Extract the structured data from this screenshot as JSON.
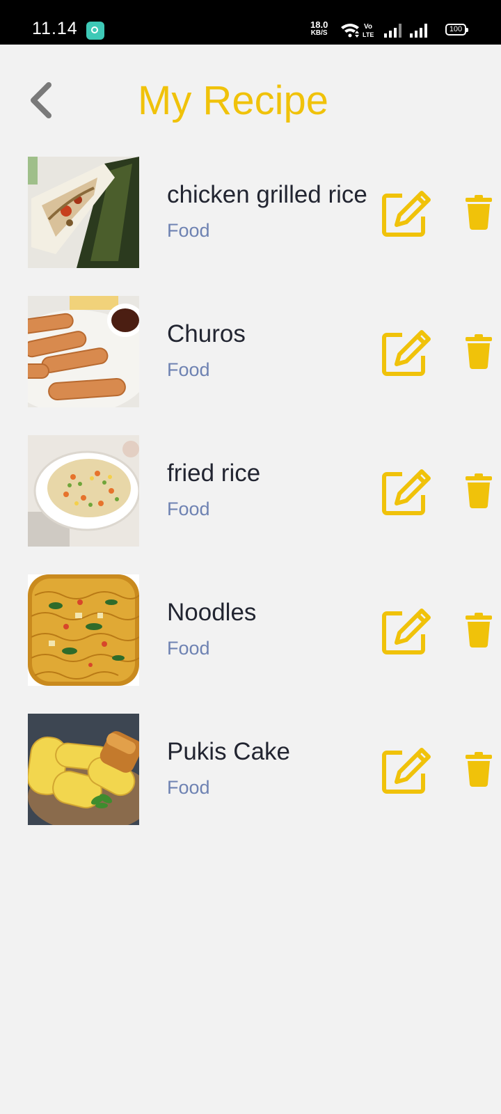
{
  "status_bar": {
    "time": "11.14",
    "net_speed": "18.0",
    "net_speed_unit": "KB/S",
    "volte": "Vo",
    "volte_sub": "LTE",
    "battery": "100"
  },
  "header": {
    "back_icon": "chevron-left-icon",
    "title": "My Recipe"
  },
  "colors": {
    "accent": "#f0c20a",
    "background": "#f2f2f2",
    "title_text": "#222531",
    "category_text": "#6e82b2"
  },
  "recipes": [
    {
      "name": "chicken grilled rice",
      "category": "Food",
      "image": "grilled-rice-in-banana-leaf-photo"
    },
    {
      "name": "Churos",
      "category": "Food",
      "image": "churros-with-chocolate-dip-photo"
    },
    {
      "name": "fried rice",
      "category": "Food",
      "image": "fried-rice-bowl-photo"
    },
    {
      "name": "Noodles",
      "category": "Food",
      "image": "instant-noodles-photo"
    },
    {
      "name": "Pukis Cake",
      "category": "Food",
      "image": "pukis-cake-photo"
    }
  ],
  "actions": {
    "edit_icon": "edit-icon",
    "delete_icon": "trash-icon"
  }
}
